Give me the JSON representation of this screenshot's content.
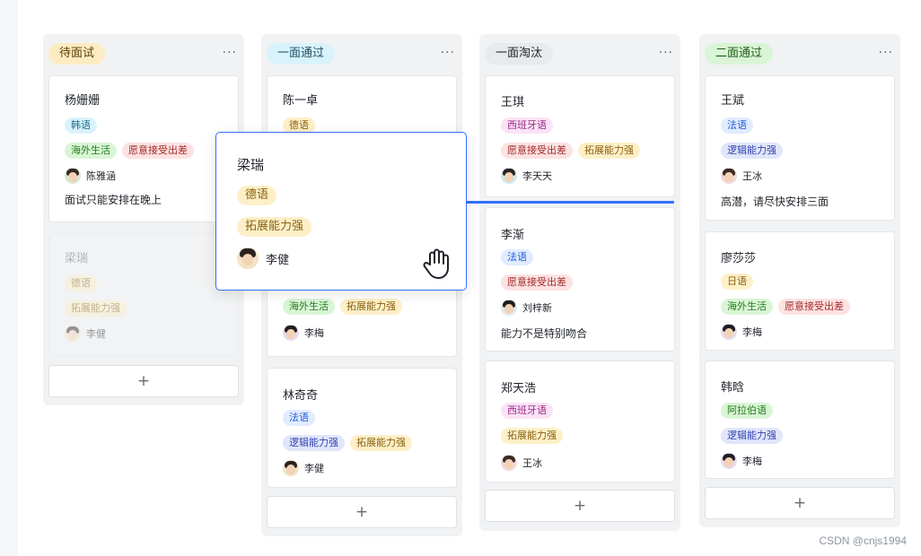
{
  "columns": [
    {
      "title": "待面试",
      "title_bg": "#fdecc3",
      "more": "···",
      "add_label": "+",
      "cards": [
        {
          "name": "杨姗姗",
          "tags1": [
            "韩语"
          ],
          "tags2": [
            "海外生活",
            "愿意接受出差"
          ],
          "person": "陈雅涵",
          "note": "面试只能安排在晚上"
        },
        {
          "name": "梁瑞",
          "tags1": [
            "德语"
          ],
          "tags2": [
            "拓展能力强"
          ],
          "person": "李健",
          "note": ""
        }
      ]
    },
    {
      "title": "一面通过",
      "title_bg": "#d9f3fd",
      "more": "···",
      "add_label": "+",
      "cards": [
        {
          "name": "陈一卓",
          "tags1": [
            "德语"
          ],
          "tags2": [
            "海外生活",
            "拓展能力强"
          ],
          "person": "李梅",
          "note": ""
        },
        {
          "name": "林奇奇",
          "tags1": [
            "法语"
          ],
          "tags2": [
            "逻辑能力强",
            "拓展能力强"
          ],
          "person": "李健",
          "note": ""
        }
      ]
    },
    {
      "title": "一面淘汰",
      "title_bg": "#e9eaec",
      "more": "···",
      "add_label": "+",
      "cards": [
        {
          "name": "王琪",
          "tags1": [
            "西班牙语"
          ],
          "tags2": [
            "愿意接受出差",
            "拓展能力强"
          ],
          "person": "李天天",
          "note": ""
        },
        {
          "name": "李渐",
          "tags1": [
            "法语"
          ],
          "tags2": [
            "愿意接受出差"
          ],
          "person": "刘梓新",
          "note": "能力不是特别吻合"
        },
        {
          "name": "郑天浩",
          "tags1": [
            "西班牙语"
          ],
          "tags2": [
            "拓展能力强"
          ],
          "person": "王冰",
          "note": ""
        }
      ]
    },
    {
      "title": "二面通过",
      "title_bg": "#d9f5d6",
      "more": "···",
      "add_label": "+",
      "cards": [
        {
          "name": "王斌",
          "tags1": [
            "法语"
          ],
          "tags2": [
            "逻辑能力强"
          ],
          "person": "王冰",
          "note": "高潜，请尽快安排三面"
        },
        {
          "name": "廖莎莎",
          "tags1": [
            "日语"
          ],
          "tags2": [
            "海外生活",
            "愿意接受出差"
          ],
          "person": "李梅",
          "note": ""
        },
        {
          "name": "韩晗",
          "tags1": [
            "阿拉伯语"
          ],
          "tags2": [
            "逻辑能力强"
          ],
          "person": "李梅",
          "note": ""
        }
      ]
    }
  ],
  "drag_card": {
    "name": "梁瑞",
    "tags": [
      "德语",
      "拓展能力强"
    ],
    "person": "李健",
    "cursor": "grab-hand-icon"
  },
  "colors": {
    "accent": "#3370ff",
    "column_bg": "#f1f2f3"
  },
  "watermark": "CSDN @cnjs1994"
}
